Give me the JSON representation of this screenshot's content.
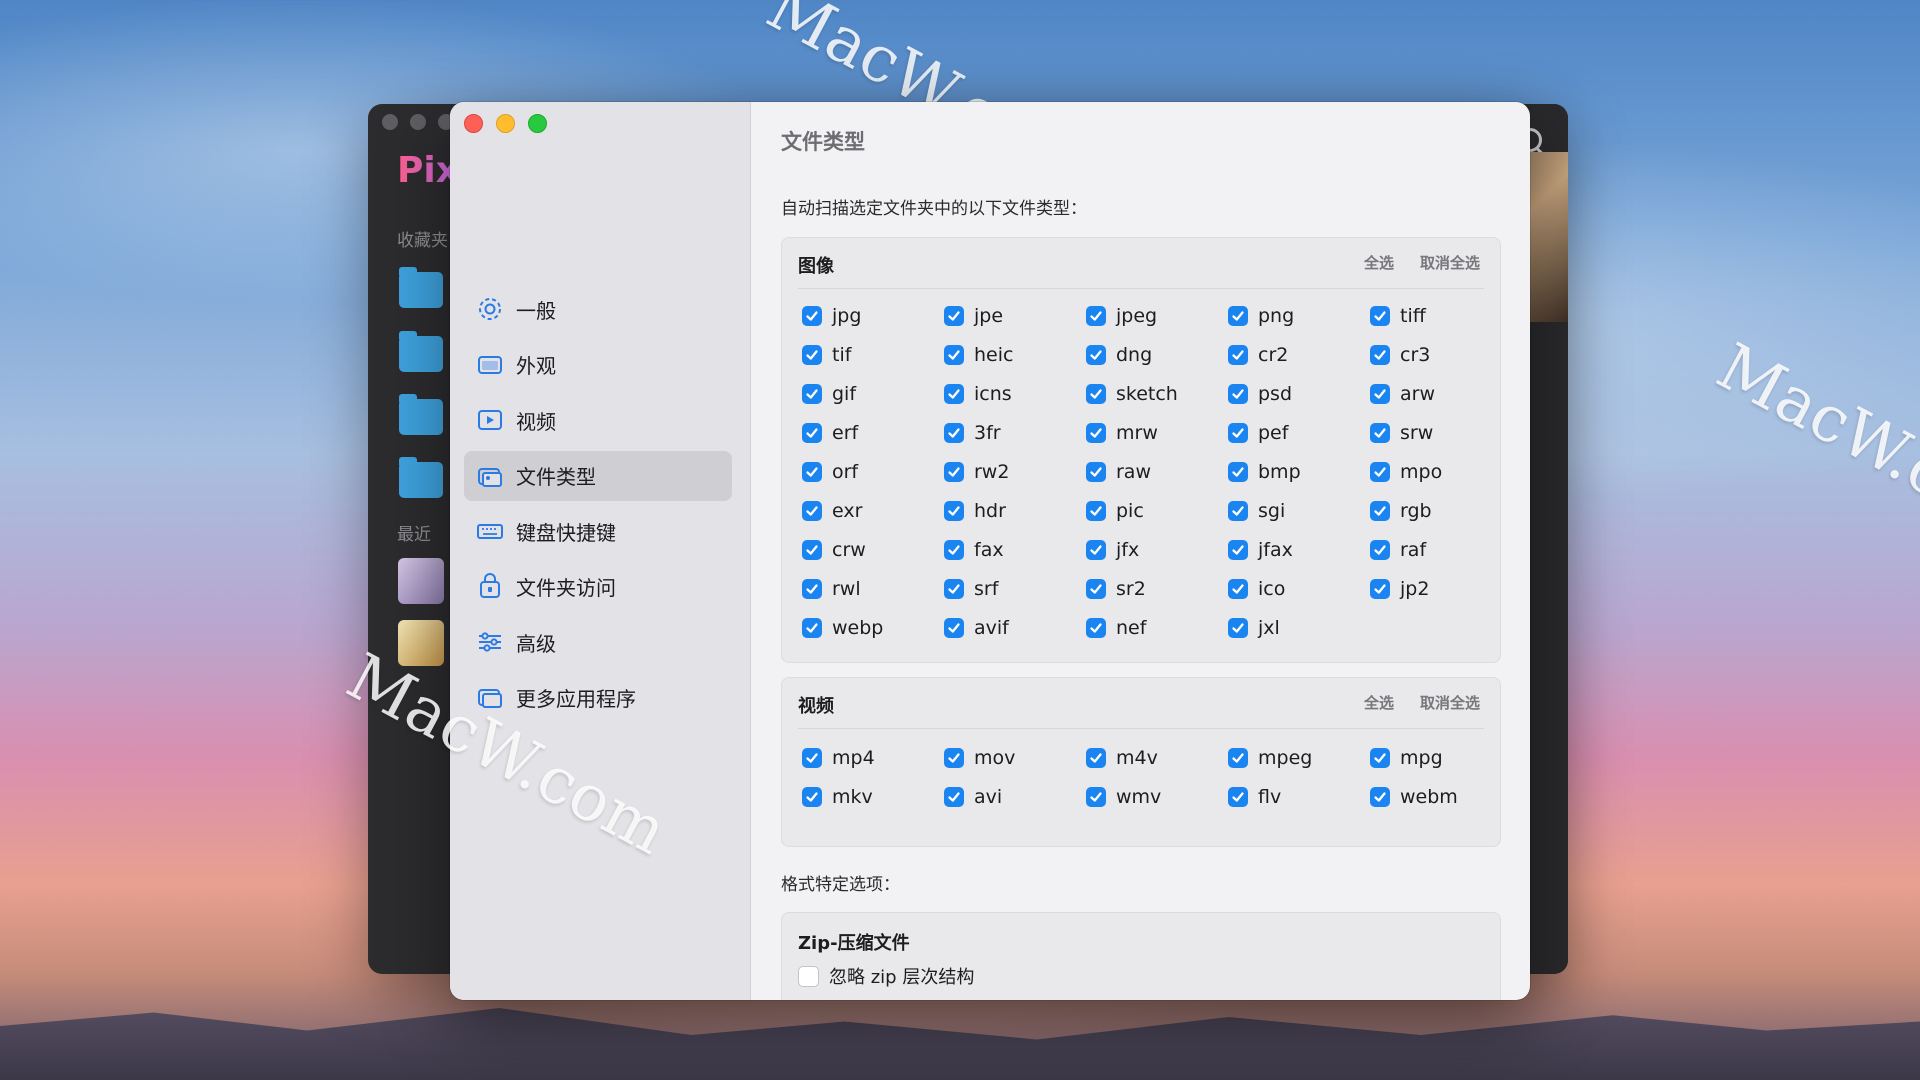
{
  "back_window": {
    "logo": "Pix",
    "favorites_label": "收藏夹",
    "recent_label": "最近"
  },
  "watermark": "MacW.com",
  "sidebar": {
    "items": [
      {
        "label": "一般",
        "icon": "gear-icon"
      },
      {
        "label": "外观",
        "icon": "window-icon"
      },
      {
        "label": "视频",
        "icon": "video-icon"
      },
      {
        "label": "文件类型",
        "icon": "file-types-icon",
        "active": true
      },
      {
        "label": "键盘快捷键",
        "icon": "keyboard-icon"
      },
      {
        "label": "文件夹访问",
        "icon": "lock-folder-icon"
      },
      {
        "label": "高级",
        "icon": "sliders-icon"
      },
      {
        "label": "更多应用程序",
        "icon": "apps-icon"
      }
    ]
  },
  "content": {
    "title": "文件类型",
    "intro": "自动扫描选定文件夹中的以下文件类型：",
    "images": {
      "title": "图像",
      "select_all": "全选",
      "deselect_all": "取消全选",
      "types": [
        "jpg",
        "jpe",
        "jpeg",
        "png",
        "tiff",
        "tif",
        "heic",
        "dng",
        "cr2",
        "cr3",
        "gif",
        "icns",
        "sketch",
        "psd",
        "arw",
        "erf",
        "3fr",
        "mrw",
        "pef",
        "srw",
        "orf",
        "rw2",
        "raw",
        "bmp",
        "mpo",
        "exr",
        "hdr",
        "pic",
        "sgi",
        "rgb",
        "crw",
        "fax",
        "jfx",
        "jfax",
        "raf",
        "rwl",
        "srf",
        "sr2",
        "ico",
        "jp2",
        "webp",
        "avif",
        "nef",
        "jxl"
      ]
    },
    "videos": {
      "title": "视频",
      "select_all": "全选",
      "deselect_all": "取消全选",
      "types": [
        "mp4",
        "mov",
        "m4v",
        "mpeg",
        "mpg",
        "mkv",
        "avi",
        "wmv",
        "flv",
        "webm"
      ]
    },
    "format_options_label": "格式特定选项：",
    "zip": {
      "title": "Zip-压缩文件",
      "option": "忽略 zip 层次结构"
    }
  },
  "colors": {
    "checkbox": "#1a84f0",
    "sidebar_bg": "#e3e2e6",
    "content_bg": "#f2f2f4"
  }
}
